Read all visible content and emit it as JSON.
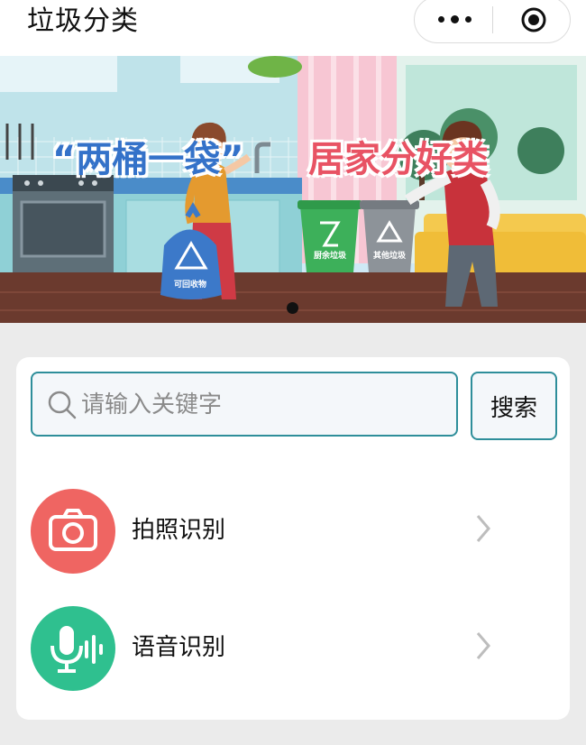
{
  "header": {
    "title": "垃圾分类",
    "menu_icon": "more-dots-icon",
    "close_icon": "target-circle-icon"
  },
  "banner": {
    "headline_left": "“两桶一袋”",
    "headline_right": "居家分好类",
    "bag_label": "可回收物",
    "green_bin_label": "厨余垃圾",
    "gray_bin_label": "其他垃圾",
    "indicator_count": 1
  },
  "search": {
    "placeholder": "请输入关键字",
    "value": "",
    "button_label": "搜索"
  },
  "actions": [
    {
      "label": "拍照识别",
      "icon": "camera-icon",
      "color": "#ef6562"
    },
    {
      "label": "语音识别",
      "icon": "microphone-icon",
      "color": "#2fc08f"
    }
  ],
  "colors": {
    "accent": "#2e8e9a",
    "background": "#ebebeb"
  }
}
